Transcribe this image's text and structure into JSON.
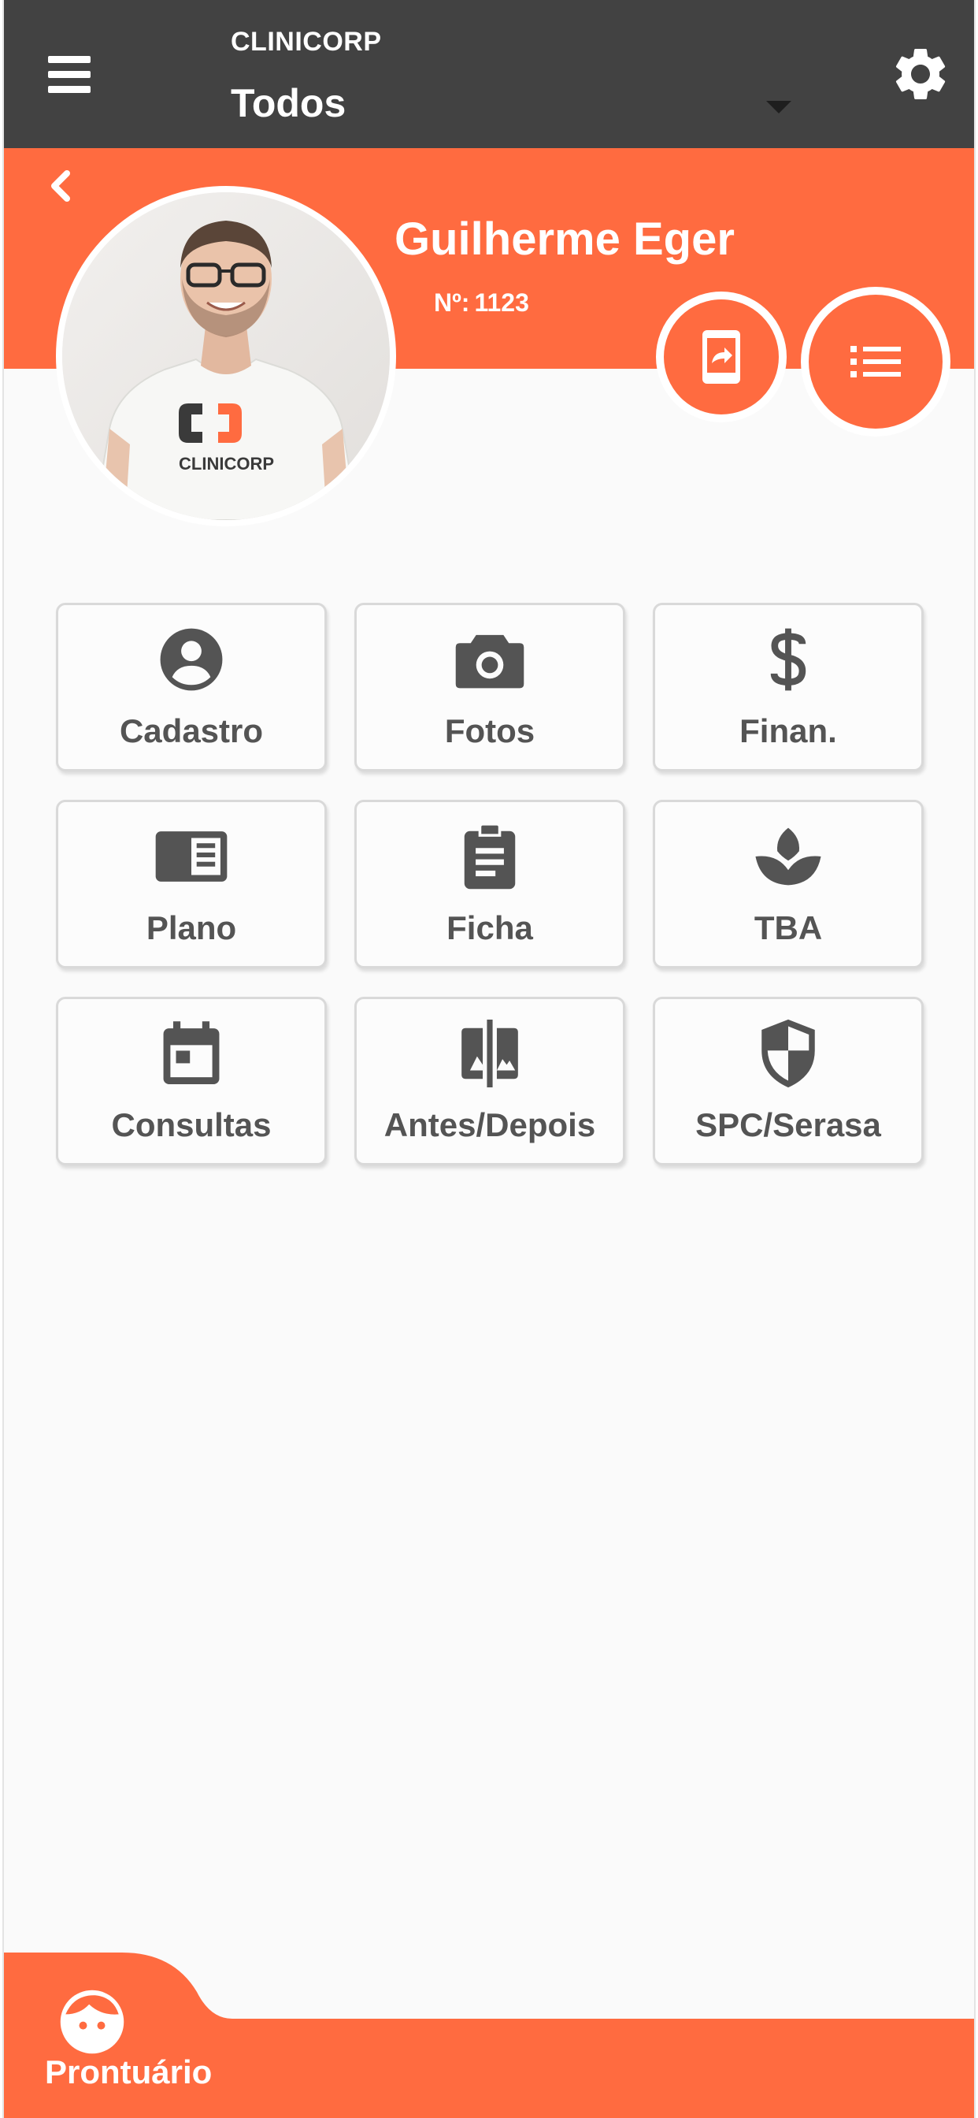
{
  "topbar": {
    "brand": "CLINICORP",
    "selected_filter": "Todos"
  },
  "patient": {
    "name": "Guilherme Eger",
    "number_label": "Nº:",
    "number": "1123",
    "photo_shirt_text": "CLINICORP"
  },
  "menu": {
    "tiles": [
      {
        "label": "Cadastro",
        "icon": "account-circle-icon"
      },
      {
        "label": "Fotos",
        "icon": "camera-icon"
      },
      {
        "label": "Finan.",
        "icon": "dollar-icon"
      },
      {
        "label": "Plano",
        "icon": "book-open-icon"
      },
      {
        "label": "Ficha",
        "icon": "clipboard-icon"
      },
      {
        "label": "TBA",
        "icon": "spa-icon"
      },
      {
        "label": "Consultas",
        "icon": "calendar-icon"
      },
      {
        "label": "Antes/Depois",
        "icon": "compare-icon"
      },
      {
        "label": "SPC/Serasa",
        "icon": "shield-icon"
      }
    ]
  },
  "bottom_nav": {
    "active_tab": "Prontuário"
  },
  "colors": {
    "accent": "#ff6b40",
    "topbar": "#424242",
    "icon": "#545454"
  }
}
